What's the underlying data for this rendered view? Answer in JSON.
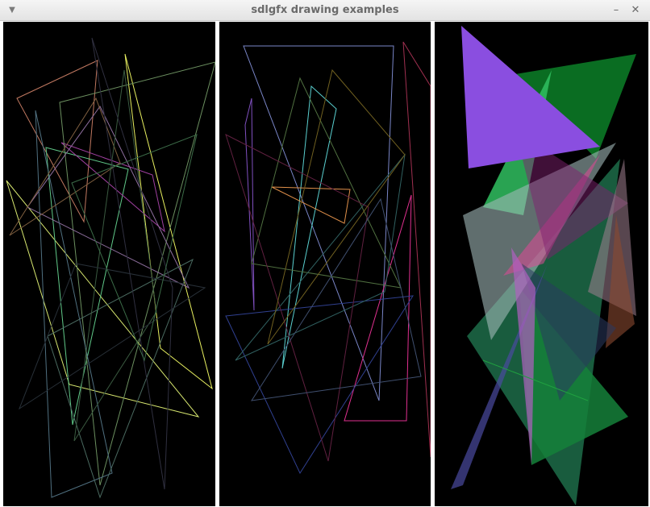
{
  "window": {
    "title": "sdlgfx drawing examples",
    "menu_icon": "chevron-down-icon",
    "minimize_icon": "minimize-icon",
    "close_icon": "close-icon"
  },
  "panels": [
    {
      "id": "left",
      "content": "random line polygons"
    },
    {
      "id": "middle",
      "content": "random line polygons"
    },
    {
      "id": "right",
      "content": "random filled translucent triangles"
    }
  ]
}
